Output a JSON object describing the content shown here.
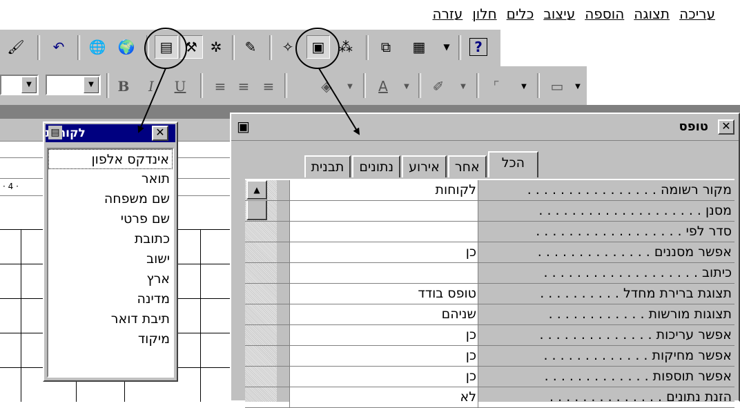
{
  "menubar": {
    "items": [
      "עריכה",
      "תצוגה",
      "הוספה",
      "עיצוב",
      "כלים",
      "חלון",
      "עזרה"
    ]
  },
  "toolbar": {
    "icons": [
      "brush-icon",
      "undo-icon",
      "web-icon",
      "globe-icon",
      "field-list-icon",
      "toolbox-icon",
      "autoformat-icon",
      "code-icon",
      "properties-icon",
      "build-icon",
      "new-object-icon",
      "database-window-icon",
      "help-icon"
    ]
  },
  "formatting": {
    "bold": "B",
    "italic": "I",
    "underline": "U",
    "font_color": "A"
  },
  "ruler": {
    "marks": "· 4 ·"
  },
  "field_list": {
    "title": "לקוחות",
    "items": [
      "אינדקס אלפון",
      "תואר",
      "שם משפחה",
      "שם פרטי",
      "כתובת",
      "ישוב",
      "ארץ",
      "מדינה",
      "תיבת דואר",
      "מיקוד"
    ]
  },
  "properties": {
    "title": "טופס",
    "tabs": [
      "הכל",
      "אחר",
      "אירוע",
      "נתונים",
      "תבנית"
    ],
    "active_tab": "הכל",
    "rows": [
      {
        "label": "מקור רשומה . . . . . . . . . . . . . . . .",
        "value": "לקוחות"
      },
      {
        "label": "מסנן . . . . . . . . . . . . . . . . . . . .",
        "value": ""
      },
      {
        "label": "סדר לפי . . . . . . . . . . . . . . . . . .",
        "value": ""
      },
      {
        "label": "אפשר מסננים . . . . . . . . . . . . . .",
        "value": "כן"
      },
      {
        "label": "כיתוב . . . . . . . . . . . . . . . . . . .",
        "value": ""
      },
      {
        "label": "תצוגת ברירת מחדל . . . . . . . . . .",
        "value": "טופס בודד"
      },
      {
        "label": "תצוגות מורשות . . . . . . . . . . . .",
        "value": "שניהם"
      },
      {
        "label": "אפשר עריכות . . . . . . . . . . . . . .",
        "value": "כן"
      },
      {
        "label": "אפשר מחיקות . . . . . . . . . . . . .",
        "value": "כן"
      },
      {
        "label": "אפשר תוספות . . . . . . . . . . . . .",
        "value": "כן"
      },
      {
        "label": "הזנת נתונים . . . . . . . . . . . . . .",
        "value": "לא"
      }
    ]
  }
}
